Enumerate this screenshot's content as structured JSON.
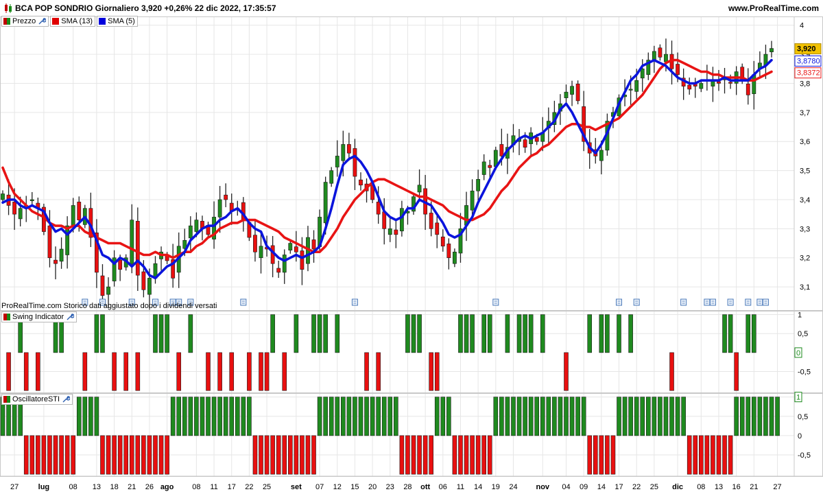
{
  "header": {
    "title": "BCA POP SONDRIO Giornaliero 3,920 +0,26% 22 dic 2022, 17:35:57",
    "site": "www.ProRealTime.com"
  },
  "panels": {
    "price": {
      "legend": [
        {
          "label": "Prezzo",
          "color": "#1a8a1a"
        },
        {
          "label": "SMA (13)",
          "color": "#e00000"
        },
        {
          "label": "SMA (5)",
          "color": "#0000dd"
        }
      ],
      "notice": "ProRealTime.com  Storico dati aggiustato dopo i dividendi versati",
      "last_price_label": "3,920",
      "sma5_label": "3,8780",
      "sma13_label": "3,8372"
    },
    "swing": {
      "legend": "Swing Indicator"
    },
    "sti": {
      "legend": "OscillatoreSTI"
    }
  },
  "colors": {
    "up": "#1f8a1f",
    "down": "#e81010",
    "sma5": "#0a14dc",
    "sma13": "#e81414",
    "grid": "#e6e6e6",
    "price_tag_bg": "#f2c200"
  },
  "chart_data": [
    {
      "type": "candlestick",
      "title": "BCA POP SONDRIO Giornaliero",
      "ylim": [
        3.02,
        4.03
      ],
      "yticks": [
        {
          "v": 4.0,
          "label": "4"
        },
        {
          "v": 3.9,
          "label": "3,9"
        },
        {
          "v": 3.8,
          "label": "3,8"
        },
        {
          "v": 3.7,
          "label": "3,7"
        },
        {
          "v": 3.6,
          "label": "3,6"
        },
        {
          "v": 3.5,
          "label": "3,5"
        },
        {
          "v": 3.4,
          "label": "3,4"
        },
        {
          "v": 3.3,
          "label": "3,3"
        },
        {
          "v": 3.2,
          "label": "3,2"
        },
        {
          "v": 3.1,
          "label": "3,1"
        }
      ],
      "x_labels": [
        {
          "i": 2,
          "label": "27"
        },
        {
          "i": 7,
          "label": "lug",
          "bold": true
        },
        {
          "i": 12,
          "label": "08"
        },
        {
          "i": 16,
          "label": "13"
        },
        {
          "i": 19,
          "label": "18"
        },
        {
          "i": 22,
          "label": "21"
        },
        {
          "i": 25,
          "label": "26"
        },
        {
          "i": 28,
          "label": "ago",
          "bold": true
        },
        {
          "i": 33,
          "label": "08"
        },
        {
          "i": 36,
          "label": "11"
        },
        {
          "i": 39,
          "label": "17"
        },
        {
          "i": 42,
          "label": "22"
        },
        {
          "i": 45,
          "label": "25"
        },
        {
          "i": 50,
          "label": "set",
          "bold": true
        },
        {
          "i": 54,
          "label": "07"
        },
        {
          "i": 57,
          "label": "12"
        },
        {
          "i": 60,
          "label": "15"
        },
        {
          "i": 63,
          "label": "20"
        },
        {
          "i": 66,
          "label": "23"
        },
        {
          "i": 69,
          "label": "28"
        },
        {
          "i": 72,
          "label": "ott",
          "bold": true
        },
        {
          "i": 75,
          "label": "06"
        },
        {
          "i": 78,
          "label": "11"
        },
        {
          "i": 81,
          "label": "14"
        },
        {
          "i": 84,
          "label": "19"
        },
        {
          "i": 87,
          "label": "24"
        },
        {
          "i": 92,
          "label": "nov",
          "bold": true
        },
        {
          "i": 96,
          "label": "04"
        },
        {
          "i": 99,
          "label": "09"
        },
        {
          "i": 102,
          "label": "14"
        },
        {
          "i": 105,
          "label": "17"
        },
        {
          "i": 108,
          "label": "22"
        },
        {
          "i": 111,
          "label": "25"
        },
        {
          "i": 115,
          "label": "dic",
          "bold": true
        },
        {
          "i": 119,
          "label": "08"
        },
        {
          "i": 122,
          "label": "13"
        },
        {
          "i": 125,
          "label": "16"
        },
        {
          "i": 128,
          "label": "21"
        },
        {
          "i": 132,
          "label": "27"
        }
      ],
      "series": [
        {
          "name": "Prezzo",
          "type": "candles",
          "closes": [
            3.42,
            3.38,
            3.35,
            3.37,
            3.38,
            3.4,
            3.37,
            3.29,
            3.2,
            3.18,
            3.23,
            3.31,
            3.38,
            3.33,
            3.37,
            3.27,
            3.15,
            3.07,
            3.1,
            3.2,
            3.16,
            3.2,
            3.33,
            3.14,
            3.09,
            3.13,
            3.18,
            3.22,
            3.19,
            3.13,
            3.24,
            3.26,
            3.31,
            3.33,
            3.3,
            3.28,
            3.34,
            3.4,
            3.4,
            3.36,
            3.37,
            3.33,
            3.27,
            3.22,
            3.24,
            3.23,
            3.18,
            3.15,
            3.21,
            3.25,
            3.22,
            3.16,
            3.27,
            3.23,
            3.34,
            3.46,
            3.5,
            3.55,
            3.59,
            3.56,
            3.48,
            3.45,
            3.43,
            3.4,
            3.35,
            3.3,
            3.3,
            3.28,
            3.37,
            3.36,
            3.41,
            3.45,
            3.35,
            3.3,
            3.28,
            3.24,
            3.2,
            3.22,
            3.3,
            3.38,
            3.43,
            3.47,
            3.53,
            3.51,
            3.57,
            3.55,
            3.58,
            3.62,
            3.61,
            3.58,
            3.63,
            3.6,
            3.63,
            3.67,
            3.7,
            3.73,
            3.77,
            3.79,
            3.74,
            3.6,
            3.56,
            3.55,
            3.57,
            3.67,
            3.7,
            3.75,
            3.76,
            3.78,
            3.81,
            3.85,
            3.88,
            3.91,
            3.89,
            3.9,
            3.85,
            3.83,
            3.79,
            3.78,
            3.79,
            3.8,
            3.81,
            3.81,
            3.8,
            3.82,
            3.8,
            3.84,
            3.81,
            3.76,
            3.83,
            3.87,
            3.9,
            3.92
          ]
        },
        {
          "name": "SMA (13)",
          "type": "line",
          "values": [
            3.51,
            3.46,
            3.42,
            3.4,
            3.38,
            3.36,
            3.35,
            3.34,
            3.32,
            3.31,
            3.31,
            3.3,
            3.31,
            3.31,
            3.29,
            3.28,
            3.27,
            3.26,
            3.25,
            3.25,
            3.25,
            3.24,
            3.23,
            3.22,
            3.21,
            3.21,
            3.22,
            3.21,
            3.21,
            3.2,
            3.21,
            3.22,
            3.22,
            3.24,
            3.25,
            3.27,
            3.28,
            3.3,
            3.31,
            3.32,
            3.32,
            3.33,
            3.33,
            3.33,
            3.32,
            3.31,
            3.3,
            3.29,
            3.27,
            3.26,
            3.25,
            3.24,
            3.23,
            3.22,
            3.22,
            3.24,
            3.27,
            3.3,
            3.34,
            3.37,
            3.4,
            3.42,
            3.44,
            3.46,
            3.47,
            3.47,
            3.46,
            3.45,
            3.44,
            3.43,
            3.42,
            3.41,
            3.41,
            3.4,
            3.39,
            3.38,
            3.36,
            3.35,
            3.34,
            3.33,
            3.33,
            3.34,
            3.35,
            3.37,
            3.4,
            3.43,
            3.45,
            3.48,
            3.51,
            3.53,
            3.55,
            3.56,
            3.58,
            3.59,
            3.61,
            3.63,
            3.65,
            3.66,
            3.66,
            3.65,
            3.65,
            3.64,
            3.65,
            3.66,
            3.67,
            3.68,
            3.7,
            3.72,
            3.74,
            3.76,
            3.79,
            3.82,
            3.85,
            3.87,
            3.88,
            3.88,
            3.87,
            3.86,
            3.85,
            3.84,
            3.84,
            3.83,
            3.83,
            3.82,
            3.82,
            3.82,
            3.82,
            3.81,
            3.81,
            3.82,
            3.83,
            3.84
          ]
        },
        {
          "name": "SMA (5)",
          "type": "line",
          "values": [
            3.39,
            3.4,
            3.4,
            3.38,
            3.37,
            3.38,
            3.37,
            3.36,
            3.32,
            3.29,
            3.3,
            3.28,
            3.3,
            3.32,
            3.34,
            3.31,
            3.26,
            3.21,
            3.2,
            3.18,
            3.2,
            3.19,
            3.17,
            3.19,
            3.17,
            3.14,
            3.13,
            3.15,
            3.17,
            3.18,
            3.2,
            3.22,
            3.26,
            3.28,
            3.3,
            3.31,
            3.31,
            3.33,
            3.34,
            3.36,
            3.37,
            3.35,
            3.32,
            3.3,
            3.29,
            3.24,
            3.22,
            3.2,
            3.19,
            3.2,
            3.21,
            3.2,
            3.21,
            3.22,
            3.24,
            3.3,
            3.37,
            3.45,
            3.52,
            3.54,
            3.55,
            3.53,
            3.5,
            3.46,
            3.41,
            3.36,
            3.34,
            3.33,
            3.34,
            3.37,
            3.37,
            3.4,
            3.39,
            3.38,
            3.35,
            3.32,
            3.28,
            3.27,
            3.28,
            3.31,
            3.34,
            3.39,
            3.43,
            3.47,
            3.51,
            3.54,
            3.57,
            3.59,
            3.61,
            3.62,
            3.61,
            3.62,
            3.63,
            3.65,
            3.67,
            3.71,
            3.73,
            3.7,
            3.66,
            3.62,
            3.58,
            3.56,
            3.59,
            3.63,
            3.68,
            3.73,
            3.77,
            3.81,
            3.83,
            3.86,
            3.87,
            3.88,
            3.87,
            3.86,
            3.84,
            3.82,
            3.81,
            3.8,
            3.8,
            3.81,
            3.81,
            3.81,
            3.81,
            3.82,
            3.81,
            3.81,
            3.81,
            3.81,
            3.83,
            3.85,
            3.86,
            3.88
          ]
        }
      ]
    },
    {
      "type": "bar",
      "title": "Swing Indicator",
      "ylim": [
        -1.05,
        1.1
      ],
      "yticks": [
        {
          "v": 1,
          "label": "1"
        },
        {
          "v": 0.5,
          "label": "0,5"
        },
        {
          "v": -0.5,
          "label": "-0,5"
        }
      ],
      "current_value_label": "0",
      "values": [
        0,
        -1,
        0,
        1,
        -1,
        0,
        -1,
        0,
        0,
        1,
        1,
        0,
        0,
        0,
        -1,
        0,
        1,
        1,
        0,
        -1,
        0,
        -1,
        0,
        -1,
        0,
        0,
        1,
        1,
        1,
        0,
        -1,
        0,
        1,
        0,
        0,
        -1,
        0,
        -1,
        0,
        -1,
        0,
        0,
        -1,
        0,
        -1,
        -1,
        1,
        0,
        -1,
        0,
        1,
        0,
        0,
        1,
        1,
        1,
        0,
        1,
        0,
        0,
        0,
        0,
        -1,
        0,
        -1,
        0,
        0,
        0,
        0,
        1,
        1,
        1,
        0,
        -1,
        -1,
        0,
        0,
        0,
        1,
        1,
        1,
        0,
        1,
        1,
        0,
        0,
        1,
        0,
        1,
        1,
        1,
        0,
        1,
        0,
        0,
        0,
        -1,
        0,
        0,
        0,
        1,
        0,
        1,
        1,
        0,
        1,
        0,
        1,
        0,
        0,
        0,
        0,
        0,
        0,
        -1,
        0,
        0,
        0,
        0,
        0,
        0,
        0,
        0,
        1,
        1,
        -1,
        0,
        1,
        1,
        0,
        0,
        0,
        0,
        0
      ]
    },
    {
      "type": "bar",
      "title": "OscillatoreSTI",
      "ylim": [
        -1.05,
        1.1
      ],
      "yticks": [
        {
          "v": 1,
          "label": "1"
        },
        {
          "v": 0.5,
          "label": "0,5"
        },
        {
          "v": 0,
          "label": "0"
        },
        {
          "v": -0.5,
          "label": "-0,5"
        }
      ],
      "current_value_label": "1",
      "values": [
        1,
        1,
        1,
        1,
        -1,
        -1,
        -1,
        -1,
        -1,
        -1,
        -1,
        -1,
        -1,
        1,
        1,
        1,
        1,
        -1,
        -1,
        -1,
        -1,
        -1,
        -1,
        -1,
        -1,
        -1,
        -1,
        -1,
        -1,
        1,
        1,
        1,
        1,
        1,
        1,
        1,
        1,
        1,
        1,
        1,
        1,
        1,
        1,
        -1,
        -1,
        -1,
        -1,
        -1,
        -1,
        -1,
        -1,
        -1,
        -1,
        -1,
        1,
        1,
        1,
        1,
        1,
        1,
        1,
        1,
        1,
        1,
        1,
        1,
        1,
        1,
        -1,
        -1,
        -1,
        -1,
        -1,
        -1,
        1,
        1,
        1,
        -1,
        -1,
        -1,
        -1,
        -1,
        -1,
        -1,
        1,
        1,
        1,
        1,
        1,
        1,
        1,
        1,
        1,
        1,
        1,
        1,
        1,
        1,
        1,
        1,
        -1,
        -1,
        -1,
        -1,
        -1,
        1,
        1,
        1,
        1,
        1,
        1,
        1,
        1,
        1,
        1,
        1,
        1,
        -1,
        -1,
        -1,
        -1,
        -1,
        -1,
        -1,
        -1,
        1,
        1,
        1,
        1,
        1,
        1,
        1,
        1,
        0,
        0,
        0,
        0
      ]
    }
  ]
}
